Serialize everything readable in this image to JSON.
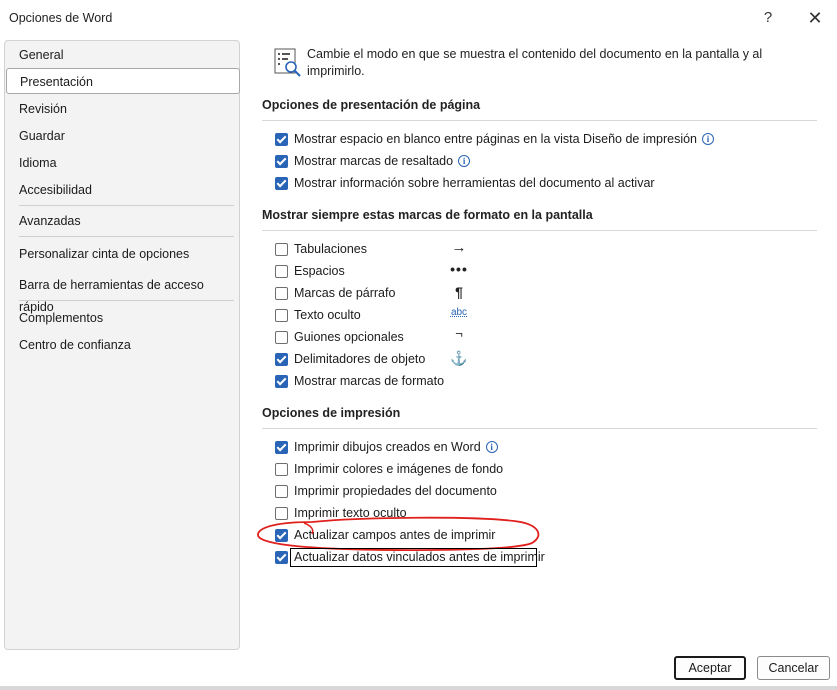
{
  "window": {
    "title": "Opciones de Word",
    "help_label": "?",
    "close_label": "✕"
  },
  "sidebar": {
    "items": [
      {
        "label": "General"
      },
      {
        "label": "Presentación",
        "selected": true
      },
      {
        "label": "Revisión"
      },
      {
        "label": "Guardar"
      },
      {
        "label": "Idioma"
      },
      {
        "label": "Accesibilidad"
      },
      {
        "label": "Avanzadas"
      },
      {
        "label": "Personalizar cinta de opciones"
      },
      {
        "label": "Barra de herramientas de acceso rápido"
      },
      {
        "label": "Complementos"
      },
      {
        "label": "Centro de confianza"
      }
    ]
  },
  "intro": {
    "text": "Cambie el modo en que se muestra el contenido del documento en la pantalla y al imprimirlo.",
    "icon": "display-options-icon"
  },
  "sections": {
    "page_display": {
      "title": "Opciones de presentación de página",
      "options": [
        {
          "label": "Mostrar espacio en blanco entre páginas en la vista Diseño de impresión",
          "checked": true,
          "info": true
        },
        {
          "label": "Mostrar marcas de resaltado",
          "checked": true,
          "info": true
        },
        {
          "label": "Mostrar información sobre herramientas del documento al activar",
          "checked": true
        }
      ]
    },
    "formatting_marks": {
      "title": "Mostrar siempre estas marcas de formato en la pantalla",
      "options": [
        {
          "label": "Tabulaciones",
          "checked": false,
          "mark": "→"
        },
        {
          "label": "Espacios",
          "checked": false,
          "mark": "•••"
        },
        {
          "label": "Marcas de párrafo",
          "checked": false,
          "mark": "¶"
        },
        {
          "label": "Texto oculto",
          "checked": false,
          "mark": "abc"
        },
        {
          "label": "Guiones opcionales",
          "checked": false,
          "mark": "¬"
        },
        {
          "label": "Delimitadores de objeto",
          "checked": true,
          "mark": "⚓"
        },
        {
          "label": "Mostrar marcas de formato",
          "checked": true
        }
      ]
    },
    "printing": {
      "title": "Opciones de impresión",
      "options": [
        {
          "label": "Imprimir dibujos creados en Word",
          "checked": true,
          "info": true
        },
        {
          "label": "Imprimir colores e imágenes de fondo",
          "checked": false
        },
        {
          "label": "Imprimir propiedades del documento",
          "checked": false
        },
        {
          "label": "Imprimir texto oculto",
          "checked": false
        },
        {
          "label": "Actualizar campos antes de imprimir",
          "checked": true
        },
        {
          "label": "Actualizar datos vinculados antes de imprimir",
          "checked": true
        }
      ]
    }
  },
  "buttons": {
    "ok": "Aceptar",
    "cancel": "Cancelar"
  },
  "colors": {
    "accent": "#2a64b6",
    "annotation": "#e0201c"
  }
}
